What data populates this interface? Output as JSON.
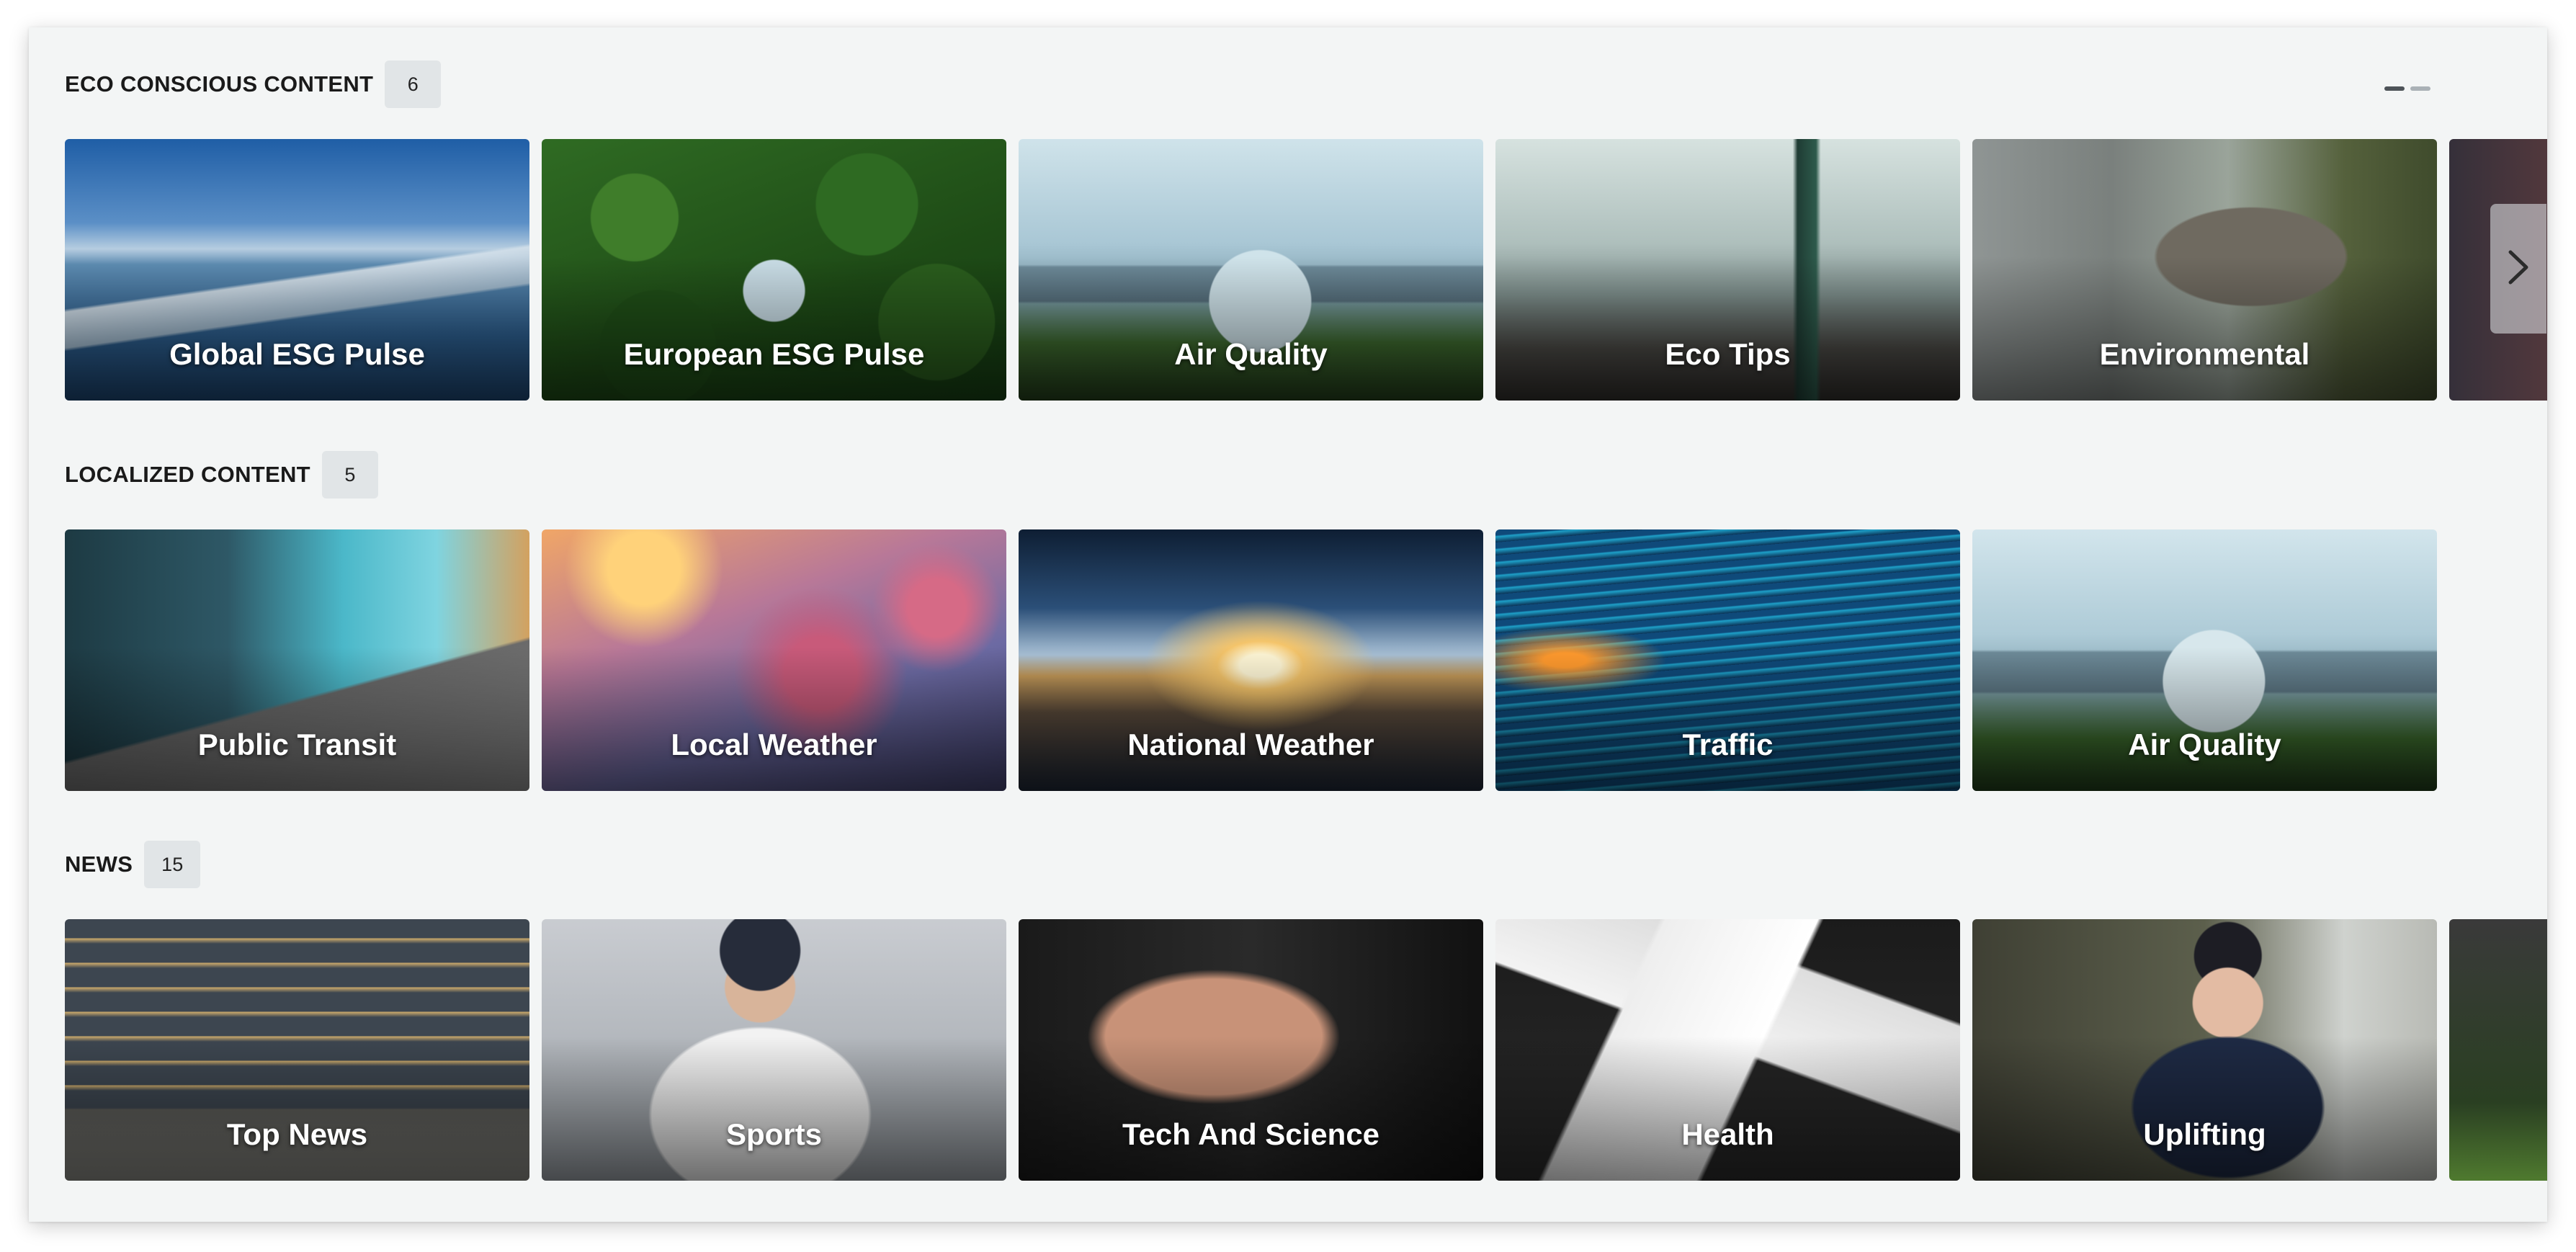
{
  "sections": [
    {
      "title": "ECO CONSCIOUS CONTENT",
      "count": "6",
      "tiles": [
        {
          "label": "Global ESG Pulse"
        },
        {
          "label": "European ESG Pulse"
        },
        {
          "label": "Air Quality"
        },
        {
          "label": "Eco Tips"
        },
        {
          "label": "Environmental"
        },
        {
          "label": ""
        }
      ]
    },
    {
      "title": "LOCALIZED CONTENT",
      "count": "5",
      "tiles": [
        {
          "label": "Public Transit"
        },
        {
          "label": "Local Weather"
        },
        {
          "label": "National Weather"
        },
        {
          "label": "Traffic"
        },
        {
          "label": "Air Quality"
        }
      ]
    },
    {
      "title": "NEWS",
      "count": "15",
      "tiles": [
        {
          "label": "Top News"
        },
        {
          "label": "Sports"
        },
        {
          "label": "Tech And Science"
        },
        {
          "label": "Health"
        },
        {
          "label": "Uplifting"
        },
        {
          "label": ""
        }
      ]
    }
  ],
  "carousel": {
    "next_icon": "chevron-right-icon",
    "pages": 2,
    "active_page": 1
  },
  "colors": {
    "panel_background": "#f3f5f5",
    "badge_background": "#e1e5e7",
    "pager_active": "#4d5358",
    "pager_inactive": "#aab1b6"
  }
}
